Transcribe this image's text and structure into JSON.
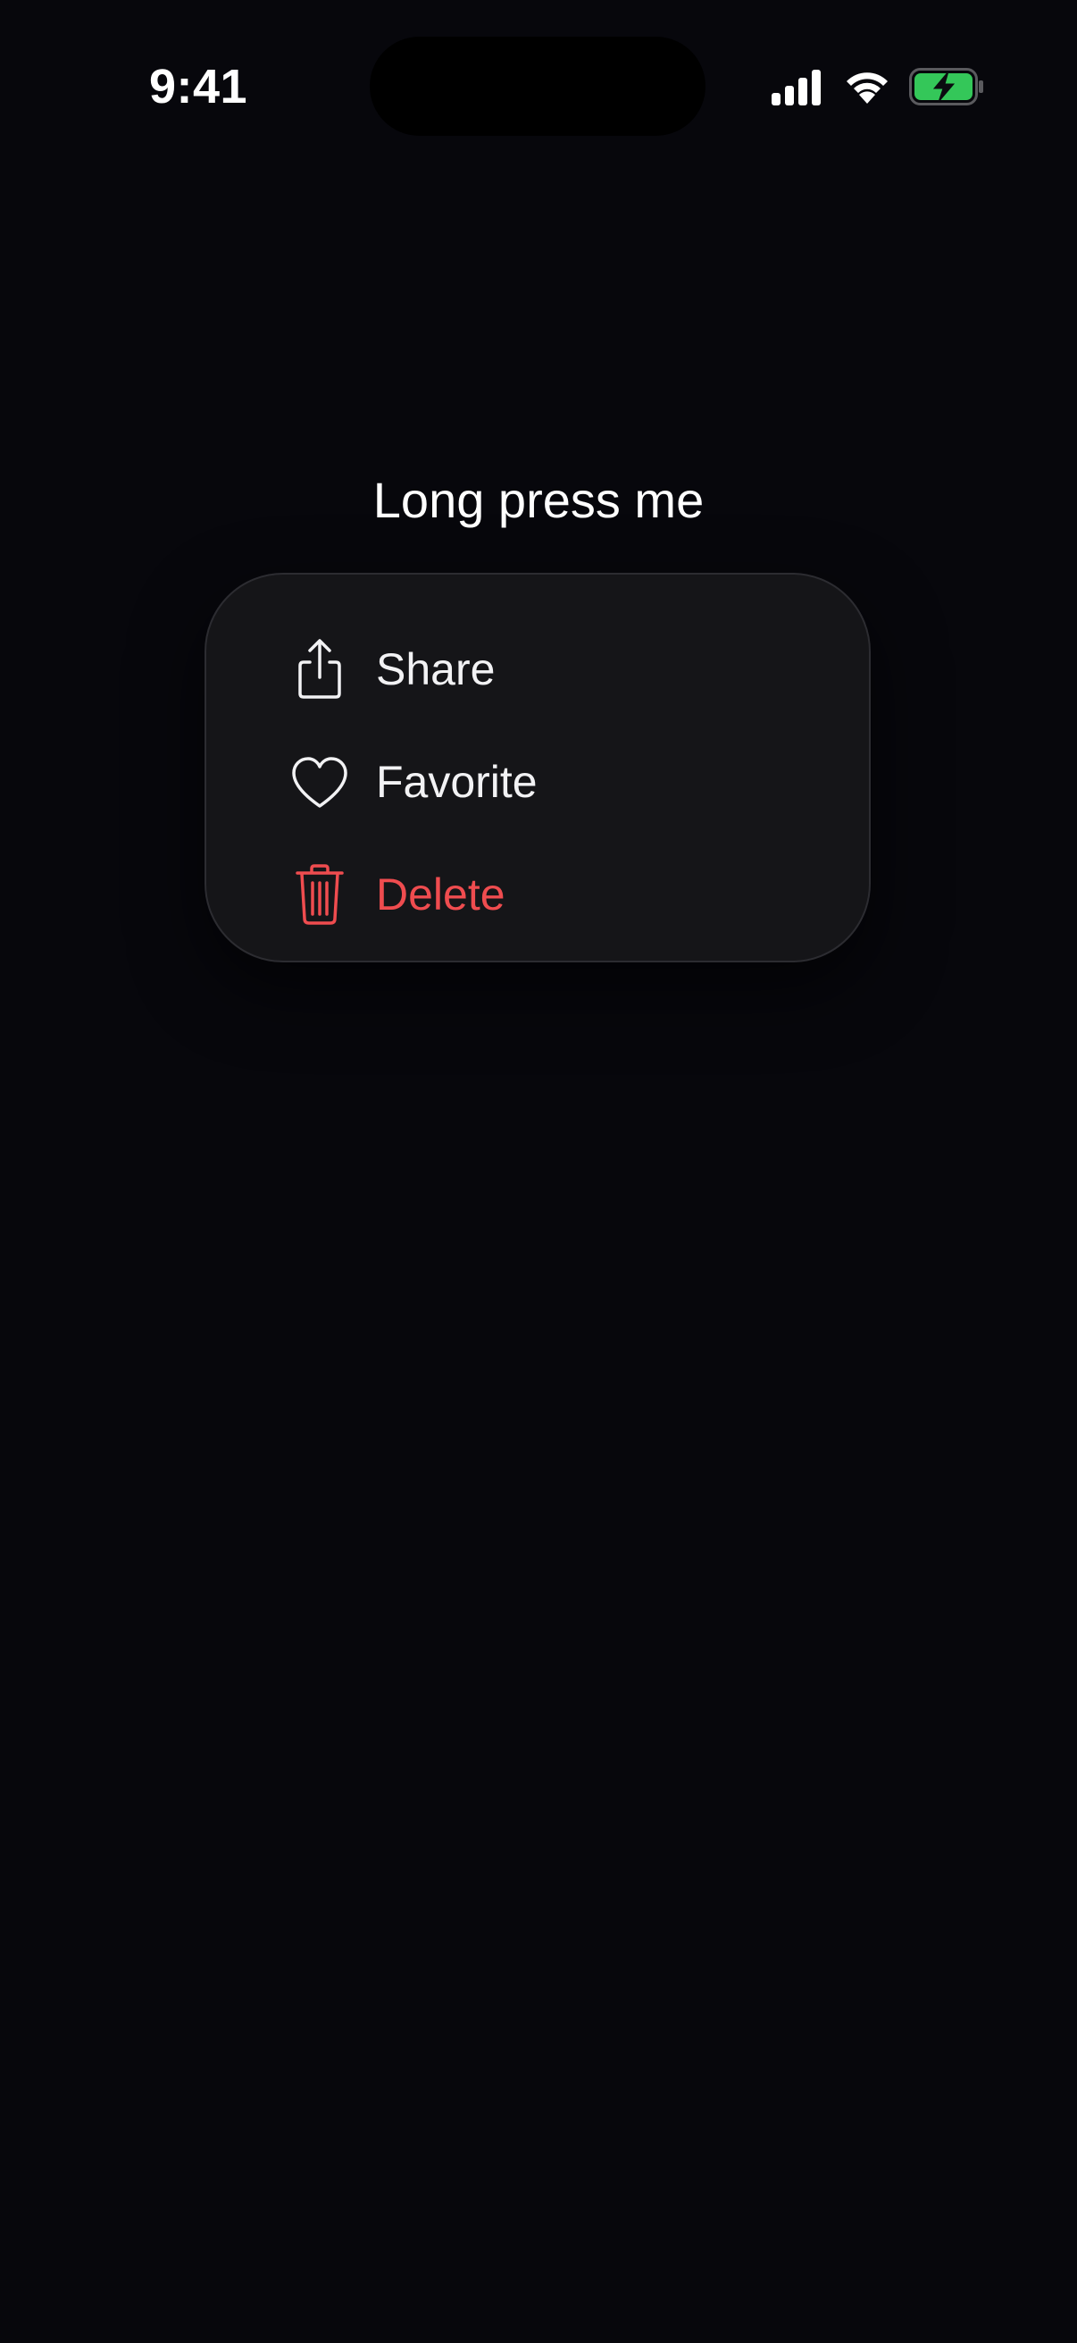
{
  "status_bar": {
    "time": "9:41"
  },
  "trigger": {
    "label": "Long press me"
  },
  "menu": {
    "items": [
      {
        "label": "Share",
        "icon": "share-icon",
        "destructive": false
      },
      {
        "label": "Favorite",
        "icon": "heart-icon",
        "destructive": false
      },
      {
        "label": "Delete",
        "icon": "trash-icon",
        "destructive": true
      }
    ]
  },
  "colors": {
    "background": "#07070c",
    "menu_background": "#151518",
    "text": "#f2f2f4",
    "destructive": "#ef4c4f",
    "battery_fill": "#34c759"
  }
}
